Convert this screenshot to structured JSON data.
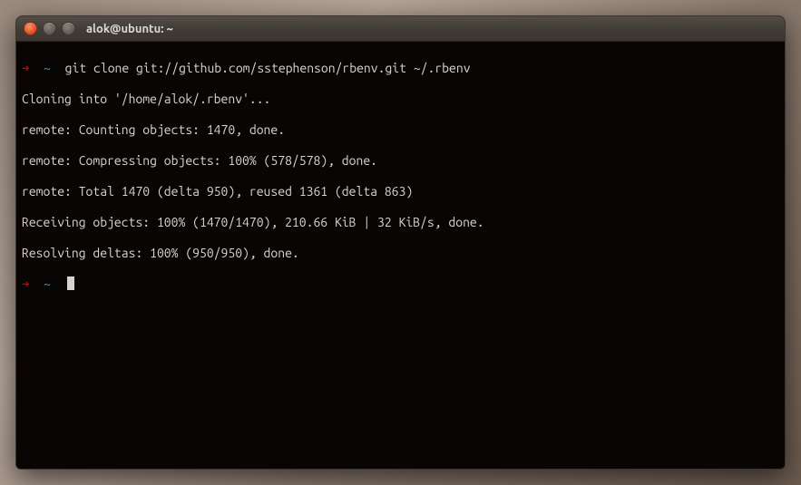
{
  "titlebar": {
    "title": "alok@ubuntu: ~"
  },
  "prompt": {
    "arrow": "➜",
    "tilde": "~"
  },
  "command": "git clone git://github.com/sstephenson/rbenv.git ~/.rbenv",
  "output": {
    "line1": "Cloning into '/home/alok/.rbenv'...",
    "line2": "remote: Counting objects: 1470, done.",
    "line3": "remote: Compressing objects: 100% (578/578), done.",
    "line4": "remote: Total 1470 (delta 950), reused 1361 (delta 863)",
    "line5": "Receiving objects: 100% (1470/1470), 210.66 KiB | 32 KiB/s, done.",
    "line6": "Resolving deltas: 100% (950/950), done."
  }
}
